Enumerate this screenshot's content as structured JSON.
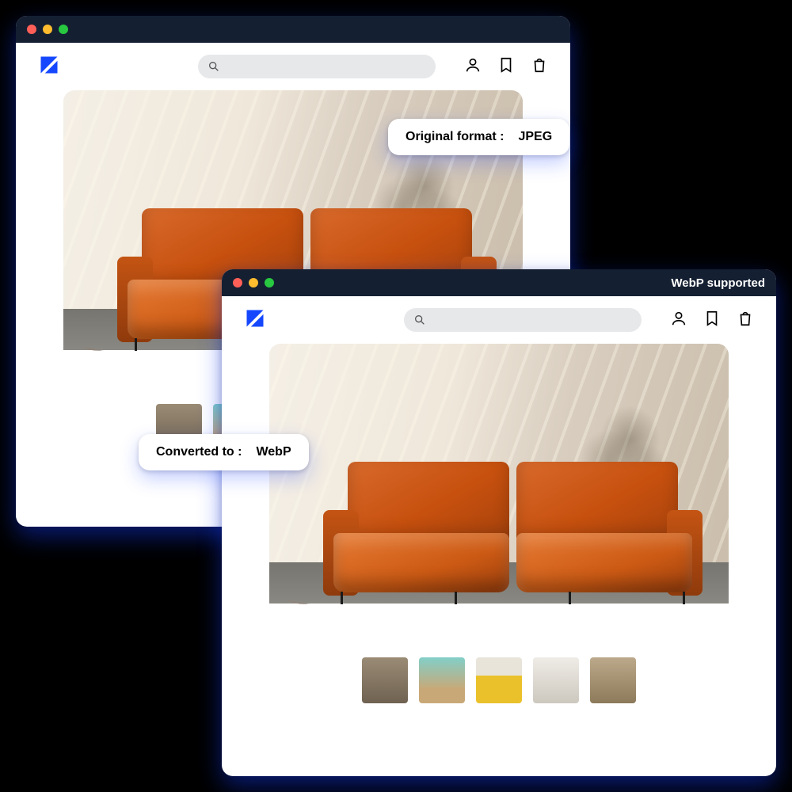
{
  "window_back": {
    "titlebar_text": "",
    "original_pill": {
      "label": "Original format :",
      "value": "JPEG"
    }
  },
  "window_front": {
    "titlebar_text": "WebP supported",
    "converted_pill": {
      "label": "Converted to :",
      "value": "WebP"
    }
  },
  "thumbnails": [
    {
      "name": "mirror",
      "bg": "linear-gradient(#9a8b75,#6f6251)"
    },
    {
      "name": "teal",
      "bg": "linear-gradient(#82cfc8,#c9a877 70%)"
    },
    {
      "name": "yellow",
      "bg": "linear-gradient(#e8e4da 0 40%, #eac12a 40%)"
    },
    {
      "name": "neutral",
      "bg": "linear-gradient(#efece7,#cdc8be)"
    },
    {
      "name": "wood",
      "bg": "linear-gradient(#bca98b,#8c7a5a)"
    }
  ],
  "icons": {
    "search": "search-icon",
    "account": "account-icon",
    "bookmark": "bookmark-icon",
    "bag": "shopping-bag-icon"
  }
}
